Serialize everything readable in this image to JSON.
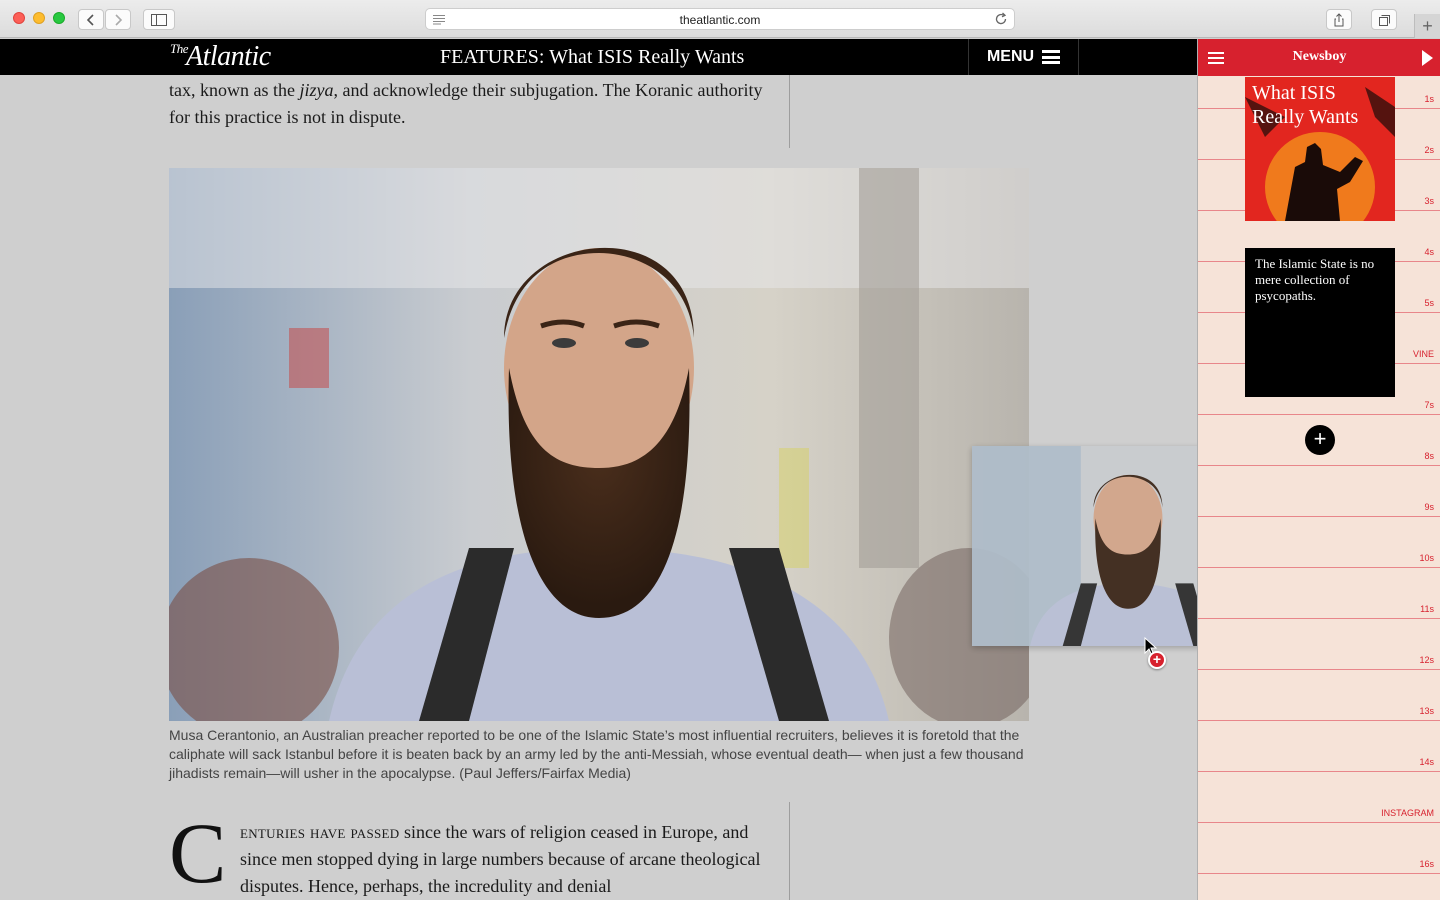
{
  "browser": {
    "url": "theatlantic.com"
  },
  "site": {
    "logo_the": "The",
    "logo_name": "Atlantic",
    "section_title": "FEATURES: What ISIS Really Wants",
    "menu_label": "MENU"
  },
  "article": {
    "para_top_1": "tax, known as the ",
    "para_top_em": "jizya",
    "para_top_2": ", and acknowledge their subjugation. The Koranic authority for this practice is not in dispute.",
    "caption": "Musa Cerantonio, an Australian preacher reported to be one of the Islamic State’s most influential recruiters, believes it is foretold that the caliphate will sack Istanbul before it is beaten back by an army led by the anti-Messiah, whose eventual death— when just a few thousand jihadists remain—will usher in the apocalypse. (Paul Jeffers/Fairfax Media)",
    "dropcap": "C",
    "smallcaps": "enturies have passed",
    "para_bottom": " since the wars of religion ceased in Europe, and since men stopped dying in large numbers because of arcane theological disputes. Hence, perhaps, the incredulity and denial"
  },
  "newsboy": {
    "title": "Newsboy",
    "card1_title": "What ISIS Really Wants",
    "card2_text": "The Islamic State is no mere collection of psycopaths.",
    "add_label": "+",
    "ticks": [
      "1s",
      "2s",
      "3s",
      "4s",
      "5s",
      "VINE",
      "7s",
      "8s",
      "9s",
      "10s",
      "11s",
      "12s",
      "13s",
      "14s",
      "INSTAGRAM",
      "16s"
    ]
  },
  "drag": {
    "badge": "+"
  },
  "colors": {
    "accent_red": "#d7212e",
    "panel_bg": "#f6e3d8",
    "header_black": "#000000"
  }
}
